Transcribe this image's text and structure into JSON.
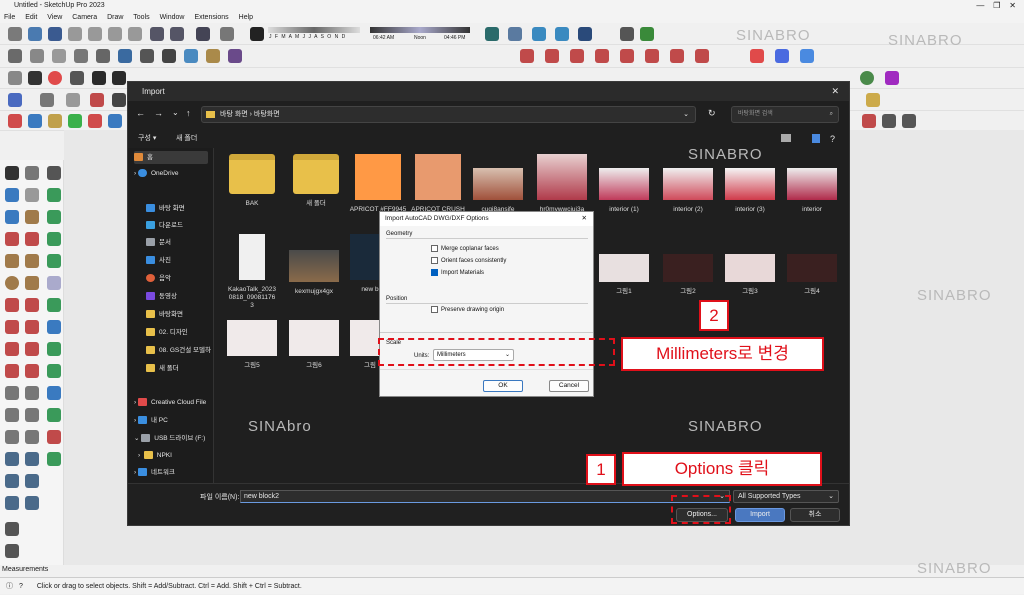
{
  "app": {
    "title": "Untitled - SketchUp Pro 2023",
    "menus": [
      "File",
      "Edit",
      "View",
      "Camera",
      "Draw",
      "Tools",
      "Window",
      "Extensions",
      "Help"
    ],
    "months": "J F M A M J J A S O N D",
    "time_start": "06:42 AM",
    "time_noon": "Noon",
    "time_end": "04:46 PM",
    "measurements_label": "Measurements",
    "status_text": "Click or drag to select objects. Shift = Add/Subtract. Ctrl = Add. Shift + Ctrl = Subtract.",
    "watermark": "SINABRO",
    "watermark_alt": "SINAbro"
  },
  "import_dialog": {
    "title": "Import",
    "breadcrumb": "바탕 화면  ›  바탕화면",
    "search_placeholder": "바탕화면 검색",
    "organize": "구성 ▾",
    "new_folder": "새 폴더",
    "nav_items": [
      {
        "label": "홈",
        "color": "#e08a3a"
      },
      {
        "label": "OneDrive",
        "color": "#3a8ee0"
      },
      {
        "label": "바탕 화면",
        "color": "#3a8ee0"
      },
      {
        "label": "다운로드",
        "color": "#3aa0e0"
      },
      {
        "label": "문서",
        "color": "#9aa0a8"
      },
      {
        "label": "사진",
        "color": "#3a8ee0"
      },
      {
        "label": "음악",
        "color": "#e0603a"
      },
      {
        "label": "동영상",
        "color": "#7a4ae0"
      },
      {
        "label": "바탕화면",
        "color": "#e8c04a"
      },
      {
        "label": "02. 디자인",
        "color": "#e8c04a"
      },
      {
        "label": "08. GS건설 모델하",
        "color": "#e8c04a"
      },
      {
        "label": "새 폴더",
        "color": "#e8c04a"
      },
      {
        "label": "Creative Cloud File",
        "color": "#e04a4a"
      },
      {
        "label": "내 PC",
        "color": "#3a8ee0"
      },
      {
        "label": "USB 드라이브 (F:)",
        "color": "#9aa0a8"
      },
      {
        "label": "NPKI",
        "color": "#e8c04a"
      },
      {
        "label": "네트워크",
        "color": "#3a8ee0"
      }
    ],
    "files": [
      {
        "label": "BAK"
      },
      {
        "label": "새 폴더"
      },
      {
        "label": "APRICOT #FF9945"
      },
      {
        "label": "APRICOT CRUSH"
      },
      {
        "label": "cuqi8ansjfe"
      },
      {
        "label": "hr0mywwcjuj3a"
      },
      {
        "label": "interior (1)"
      },
      {
        "label": "interior (2)"
      },
      {
        "label": "interior (3)"
      },
      {
        "label": "interior"
      },
      {
        "label": "KakaoTalk_20230818_090811763"
      },
      {
        "label": "kexmujgx4gx"
      },
      {
        "label": "new b"
      },
      {
        "label": "그림1"
      },
      {
        "label": "그림2"
      },
      {
        "label": "그림3"
      },
      {
        "label": "그림4"
      },
      {
        "label": "그림5"
      },
      {
        "label": "그림6"
      },
      {
        "label": "그림"
      }
    ],
    "filename_label": "파일 이름(N):",
    "filename_value": "new block2",
    "filetype": "All Supported Types",
    "options_button": "Options...",
    "import_button": "Import",
    "cancel_button": "취소"
  },
  "options_dialog": {
    "title": "Import AutoCAD DWG/DXF Options",
    "geometry_label": "Geometry",
    "merge_coplanar": "Merge coplanar faces",
    "merge_coplanar_checked": false,
    "orient_faces": "Orient faces consistently",
    "orient_faces_checked": false,
    "import_materials": "Import Materials",
    "import_materials_checked": true,
    "position_label": "Position",
    "preserve_origin": "Preserve drawing origin",
    "preserve_origin_checked": false,
    "scale_label": "Scale",
    "units_label": "Units:",
    "units_value": "Millimeters",
    "ok": "OK",
    "cancel": "Cancel"
  },
  "annotations": {
    "step1_number": "1",
    "step1_text": "Options 클릭",
    "step2_number": "2",
    "step2_text": "Millimeters로 변경"
  },
  "colors": {
    "accent_red": "#e0101a",
    "dialog_bg": "#1f1f1f"
  }
}
